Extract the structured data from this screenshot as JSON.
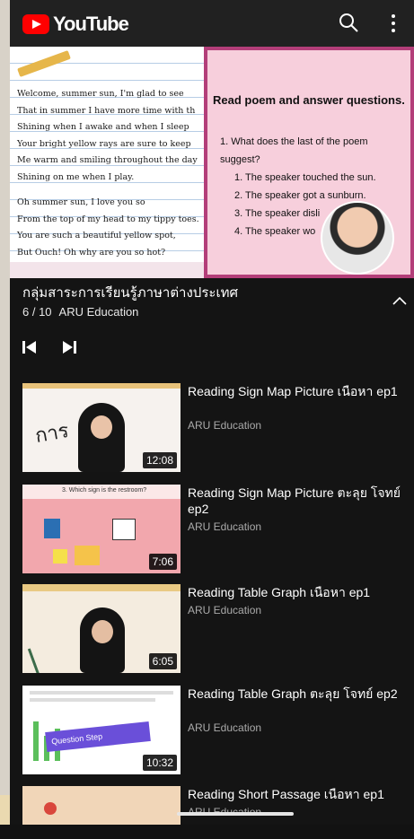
{
  "app": {
    "name": "YouTube"
  },
  "colors": {
    "brand": "#ff0000",
    "background": "#141414",
    "secondary_text": "#aaaaaa",
    "panel_border": "#b33e79"
  },
  "header": {
    "search_icon": "search-icon",
    "menu_icon": "more-vertical-icon"
  },
  "video": {
    "poem_lines": [
      "Welcome, summer sun, I'm glad to see",
      "That in summer I have more time with th",
      "Shining when I awake and when I sleep",
      "Your bright yellow rays are sure to keep",
      "Me warm and smiling throughout the day",
      "Shining on me when I play."
    ],
    "poem_lines_2": [
      "Oh summer sun, I love you so",
      "From the top of my head to my tippy toes.",
      "You are such a beautiful yellow spot,",
      "But Ouch! Oh why are you so hot?"
    ],
    "panel_title": "Read poem and answer questions.",
    "question": "1. What does the last of the poem",
    "question_cont": "suggest?",
    "options": [
      "1. The speaker touched the sun.",
      "2. The speaker got a sunburn.",
      "3. The speaker disli",
      "4. The speaker wo"
    ]
  },
  "playlist": {
    "title": "กลุ่มสาระการเรียนรู้ภาษาต่างประเทศ",
    "position": "6 / 10",
    "channel": "ARU Education",
    "items": [
      {
        "title": "Reading Sign Map Picture เนือหา ep1",
        "channel": "ARU Education",
        "duration": "12:08"
      },
      {
        "title": "Reading Sign Map Picture ตะลุย โจทย์ ep2",
        "channel": "ARU Education",
        "duration": "7:06"
      },
      {
        "title": "Reading Table Graph เนือหา ep1",
        "channel": "ARU Education",
        "duration": "6:05"
      },
      {
        "title": "Reading Table Graph ตะลุย โจทย์ ep2",
        "channel": "ARU Education",
        "duration": "10:32"
      },
      {
        "title": "Reading Short Passage เนือหา ep1",
        "channel": "ARU Education",
        "duration": ""
      }
    ],
    "thumb_text": {
      "i1": "การ",
      "i2": "3. Which sign is the restroom?",
      "i3": "Question Step"
    }
  }
}
